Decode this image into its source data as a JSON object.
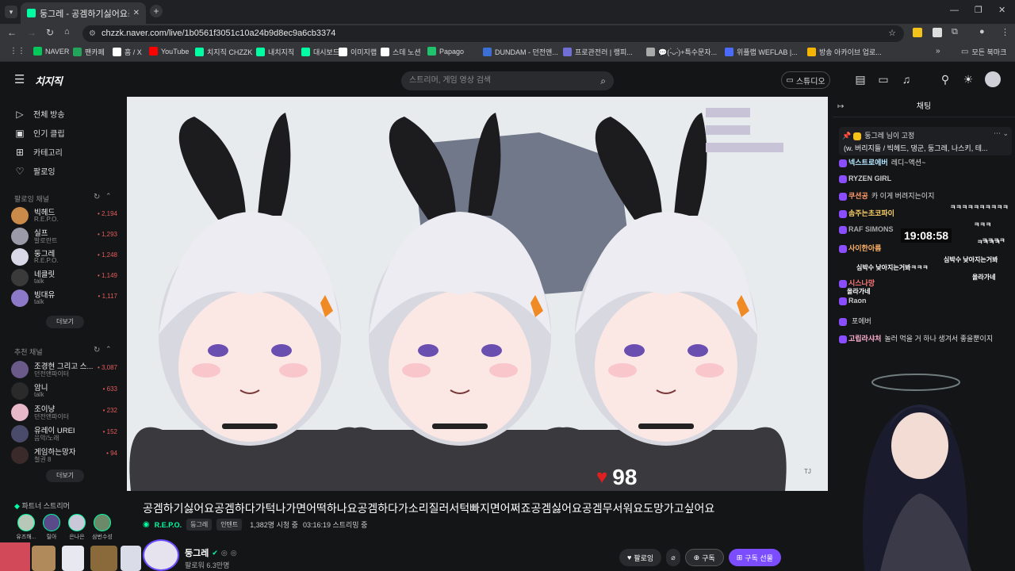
{
  "browser": {
    "tab_title": "둥그레 - 공겜하기싫어요공겜…",
    "url": "chzzk.naver.com/live/1b0561f3051c10a24b9d8ec9a6cb3374",
    "bookmarks": [
      {
        "label": "NAVER",
        "color": "#03c75a"
      },
      {
        "label": "팬카페",
        "color": "#22a55a"
      },
      {
        "label": "홈 / X",
        "color": "#ffffff"
      },
      {
        "label": "YouTube",
        "color": "#ff0000"
      },
      {
        "label": "치지직 CHZZK",
        "color": "#00ffa3"
      },
      {
        "label": "내치지직",
        "color": "#00ffa3"
      },
      {
        "label": "대시보드",
        "color": "#00ffa3"
      },
      {
        "label": "이미지랩",
        "color": "#ffffff"
      },
      {
        "label": "스데 노션",
        "color": "#ffffff"
      },
      {
        "label": "Papago",
        "color": "#1fc36d"
      },
      {
        "label": "DUNDAM - 던전앤...",
        "color": "#3b6fd6"
      },
      {
        "label": "프로관전러 | 랭피...",
        "color": "#6f6fd6"
      },
      {
        "label": "💬(-̀ᴗ-́)+특수문자...",
        "color": "#aaaaaa"
      },
      {
        "label": "위플랩 WEFLAB |...",
        "color": "#4b6bff"
      },
      {
        "label": "방송 아카이브 업로...",
        "color": "#f4b400"
      }
    ],
    "all_bookmarks": "모든 북마크"
  },
  "header": {
    "logo": "치지직",
    "search_placeholder": "스트리머, 게임 영상 검색",
    "studio_label": "스튜디오"
  },
  "sidebar": {
    "nav": [
      {
        "label": "전체 방송",
        "icon": "broadcast-icon"
      },
      {
        "label": "인기 클립",
        "icon": "clip-icon"
      },
      {
        "label": "카테고리",
        "icon": "category-icon"
      },
      {
        "label": "팔로잉",
        "icon": "heart-icon"
      }
    ],
    "following_title": "팔로잉 채널",
    "following": [
      {
        "name": "빅헤드",
        "sub": "R.E.P.O.",
        "count": "2,194",
        "color": "#c98a4a"
      },
      {
        "name": "실프",
        "sub": "발로란트",
        "count": "1,293",
        "color": "#9a9aa8"
      },
      {
        "name": "둥그레",
        "sub": "R.E.P.O.",
        "count": "1,248",
        "color": "#d8d8e8"
      },
      {
        "name": "네클릿",
        "sub": "talk",
        "count": "1,149",
        "color": "#3a3a3a"
      },
      {
        "name": "빙대유",
        "sub": "talk",
        "count": "1,117",
        "color": "#8c7ac8"
      }
    ],
    "more_label": "더보기",
    "recommend_title": "추천 채널",
    "recommend": [
      {
        "name": "조경현 그리고 스...",
        "sub": "던전앤파이터",
        "count": "3,087",
        "color": "#6a5a8a"
      },
      {
        "name": "암니",
        "sub": "talk",
        "count": "633",
        "color": "#2a2a2a"
      },
      {
        "name": "조이냥",
        "sub": "던전앤파이터",
        "count": "232",
        "color": "#e8b8c8"
      },
      {
        "name": "유레이 UREI",
        "sub": "음악/노래",
        "count": "152",
        "color": "#4a4a6a"
      },
      {
        "name": "게임하는망자",
        "sub": "철권 8",
        "count": "94",
        "color": "#3a2a2a"
      }
    ],
    "more_label2": "더보기",
    "partner_title": "파트너 스트리머",
    "partners": [
      {
        "name": "유즈해...",
        "color": "#b8c8b8"
      },
      {
        "name": "릴아",
        "color": "#5a4a8a"
      },
      {
        "name": "은나은",
        "color": "#c8c8d8"
      },
      {
        "name": "삼번수성",
        "color": "#6a8a6a"
      }
    ]
  },
  "stream": {
    "title": "공겜하기싫어요공겜하다가턱나가면어떡하나요공겜하다가소리질러서턱빠지면어쩌죠공겜싫어요공겜무서워요도망가고싶어요",
    "category": "R.E.P.O.",
    "tags": [
      "둥그레",
      "인텐트"
    ],
    "viewers": "1,382명 시청 중",
    "uptime": "03:16:19 스트리밍 중",
    "streamer_name": "둥그레",
    "followers": "팔로워 6.3만명",
    "likes": "98",
    "video_badge": "TJ"
  },
  "buttons": {
    "follow": "팔로잉",
    "subscribe": "구독",
    "gift_subscribe": "구독 선물"
  },
  "chat": {
    "title": "채팅",
    "pinned_user": "둥그레",
    "pinned_suffix": "님이 고정",
    "pinned_text": "(w. 버리지들 / 빅헤드, 댕군, 둥그레, 나스키, 테...",
    "messages": [
      {
        "user": "넥스트로에버",
        "text": "레디~액션~",
        "color": "#b3e5ff"
      },
      {
        "user": "RYZEN GIRL",
        "text": "",
        "color": "#cccccc"
      },
      {
        "user": "쿠션공",
        "text": "카 이게 버려지는이지",
        "color": "#ff9a6a"
      },
      {
        "user": "솜주는초코파이",
        "text": "",
        "color": "#ffd36a"
      },
      {
        "user": "RAF SIMONS",
        "text": "",
        "color": "#aaaaaa"
      },
      {
        "user": "사이한아름",
        "text": "",
        "color": "#ffb36a"
      },
      {
        "user": "시스나망",
        "text": "",
        "color": "#ff7a7a"
      },
      {
        "user": "Raon",
        "text": "",
        "color": "#cccccc"
      },
      {
        "user": "",
        "text": "포에버",
        "color": "#cccccc"
      },
      {
        "user": "고립라샤처",
        "text": "놀러 먹을 거 하나 생겨서 좋을뿐이지",
        "color": "#ffb0d0"
      }
    ],
    "floating": [
      "ㅋㅋㅋㅋㅋㅋㅋㅋㅋㅋ",
      "ㅋㅋㅋ",
      "ㅋㅋㅋㅋ",
      "ㅋㅋㅋㅋ",
      "심박수 낮아지는거봐",
      "올라가네",
      "올라가네",
      "심박수 낮아지는거봐ㅋㅋㅋ"
    ],
    "clock": "19:08:58"
  },
  "colors": {
    "accent": "#00ffa3",
    "live_red": "#e35b5b",
    "gift_purple": "#7b4dff"
  }
}
